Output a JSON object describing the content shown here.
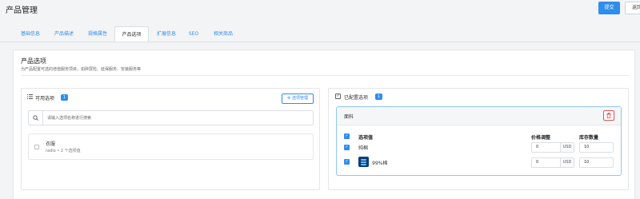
{
  "header": {
    "title": "产品管理",
    "submit_label": "提交",
    "back_label": "返回"
  },
  "tabs": [
    {
      "label": "基础信息",
      "active": false
    },
    {
      "label": "产品描述",
      "active": false
    },
    {
      "label": "规格属性",
      "active": false
    },
    {
      "label": "产品选项",
      "active": true
    },
    {
      "label": "扩展信息",
      "active": false
    },
    {
      "label": "SEO",
      "active": false
    },
    {
      "label": "相关商品",
      "active": false
    }
  ],
  "section": {
    "title": "产品选项",
    "description": "为产品配置可选的增值服务项目，如碎屏险、延保服务、安装服务等"
  },
  "available": {
    "title": "可用选项",
    "count": "1",
    "manage_label": "⚙ 选项管理",
    "search_placeholder": "请输入选项名称进行搜索",
    "items": [
      {
        "name": "衣服",
        "meta": "radio • 2 个选项值"
      }
    ]
  },
  "configured": {
    "title": "已配置选项",
    "count": "1",
    "group": {
      "name": "面料",
      "headers": {
        "value": "选项值",
        "price": "价格调整",
        "stock": "库存数量"
      },
      "rows": [
        {
          "label": "纯棉",
          "price": "0",
          "unit": "USD",
          "stock": "10",
          "has_image": false
        },
        {
          "label": "99%棉",
          "price": "0",
          "unit": "USD",
          "stock": "10",
          "has_image": true
        }
      ]
    }
  },
  "colors": {
    "primary": "#2f8ded",
    "danger": "#e0534f",
    "border_highlight": "#8ec8ee"
  }
}
